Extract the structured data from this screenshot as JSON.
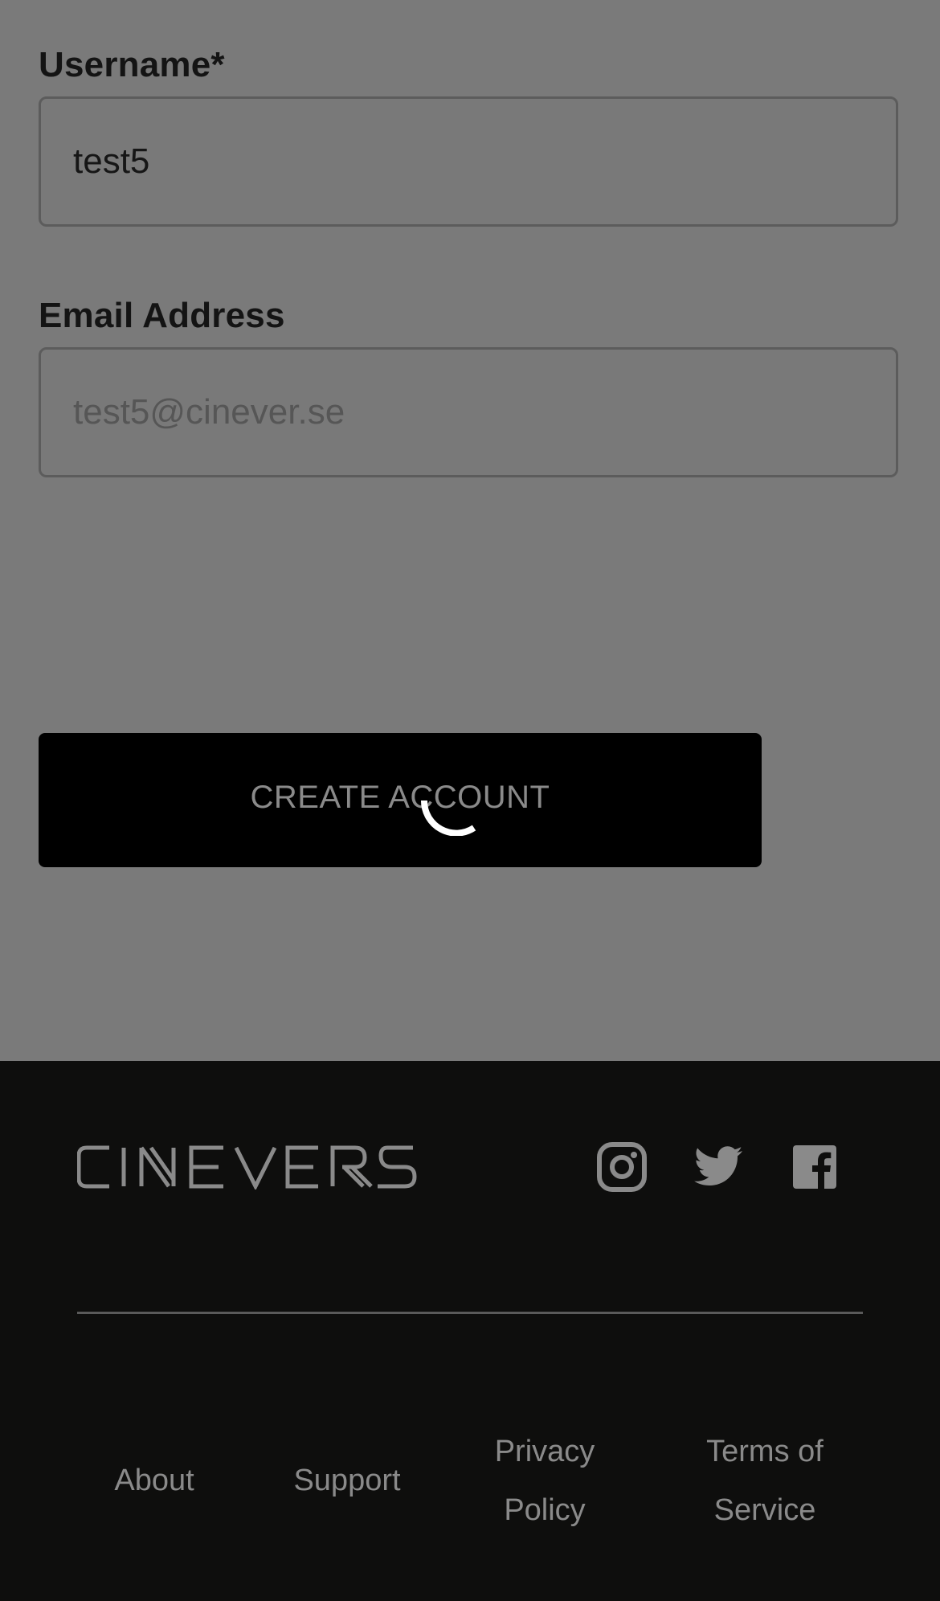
{
  "form": {
    "username": {
      "label": "Username*",
      "value": "test5"
    },
    "email": {
      "label": "Email Address",
      "placeholder": "test5@cinever.se"
    },
    "create_button": {
      "label": "CREATE ACCOUNT",
      "state": "loading"
    }
  },
  "footer": {
    "logo_text": "CINEVERSE",
    "social_icons": [
      "instagram-icon",
      "twitter-icon",
      "facebook-icon"
    ],
    "links": {
      "about": "About",
      "support": "Support",
      "privacy_line1": "Privacy",
      "privacy_line2": "Policy",
      "terms_line1": "Terms of",
      "terms_line2": "Service"
    }
  },
  "colors": {
    "overlay_background": "#7a7a7a",
    "button_background": "#000000",
    "footer_background": "#0e0e0d",
    "muted_text": "#8a8a8a",
    "spinner": "#ffffff"
  }
}
